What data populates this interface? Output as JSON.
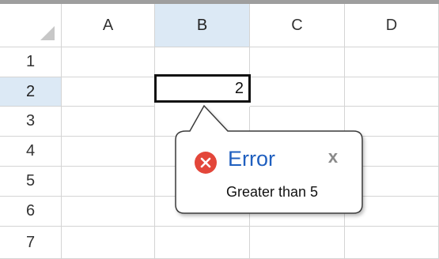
{
  "sheet": {
    "columns": [
      "A",
      "B",
      "C",
      "D"
    ],
    "rows": [
      "1",
      "2",
      "3",
      "4",
      "5",
      "6",
      "7"
    ],
    "selected_column": "B",
    "selected_row": "2"
  },
  "active_cell": {
    "value": "2"
  },
  "error_tooltip": {
    "icon": "error-x-icon",
    "title": "Error",
    "close_glyph": "x",
    "message": "Greater than 5"
  },
  "colors": {
    "header_selected_bg": "#dce9f5",
    "error_icon": "#e3463a",
    "error_title": "#1f5fbf",
    "gridline": "#d4d4d4"
  }
}
